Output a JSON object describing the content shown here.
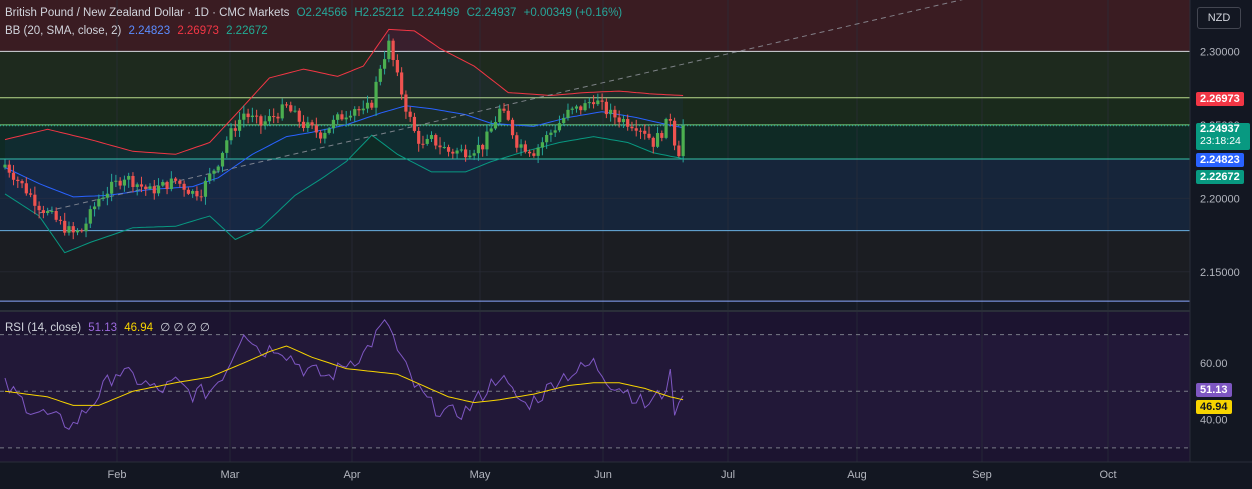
{
  "header": {
    "symbol": "British Pound / New Zealand Dollar · 1D · CMC Markets",
    "open": "O2.24566",
    "high": "H2.25212",
    "low": "L2.24499",
    "close": "C2.24937",
    "change": "+0.00349 (+0.16%)",
    "bb_title": "BB (20, SMA, close, 2)",
    "bb_basis": "2.24823",
    "bb_upper": "2.26973",
    "bb_lower": "2.22672",
    "rsi_title": "RSI (14, close)",
    "rsi_value": "51.13",
    "rsi_ma": "46.94",
    "rsi_extra": "∅ ∅ ∅ ∅"
  },
  "currency": "NZD",
  "colors": {
    "up": "#26a69a",
    "down": "#ef5350",
    "basis": "#2962ff",
    "upper": "#f23645",
    "lower": "#089981",
    "rsi": "#7e57c2",
    "rsi_ma": "#f7d400"
  },
  "chart_data": [
    {
      "type": "candlestick",
      "title": "British Pound / New Zealand Dollar · 1D · CMC Markets",
      "price_ticks": [
        "2.30000",
        "2.25000",
        "2.20000",
        "2.15000"
      ],
      "ylim": [
        2.124,
        2.335
      ],
      "x_ticks": [
        "Feb",
        "Mar",
        "Apr",
        "May",
        "Jun",
        "Jul",
        "Aug",
        "Sep",
        "Oct"
      ],
      "price_labels": {
        "upper": "2.26973",
        "last": "2.24937",
        "countdown": "23:18:24",
        "basis": "2.24823",
        "lower": "2.22672"
      },
      "horizontal_levels": [
        2.3,
        2.2685,
        2.25,
        2.2268,
        2.178,
        2.13
      ],
      "series_keyframes": {
        "close": [
          [
            0,
            2.223
          ],
          [
            8,
            2.195
          ],
          [
            14,
            2.18
          ],
          [
            16,
            2.176
          ],
          [
            18,
            2.178
          ],
          [
            22,
            2.2
          ],
          [
            28,
            2.215
          ],
          [
            34,
            2.205
          ],
          [
            40,
            2.212
          ],
          [
            44,
            2.204
          ],
          [
            46,
            2.205
          ],
          [
            50,
            2.225
          ],
          [
            52,
            2.24
          ],
          [
            56,
            2.258
          ],
          [
            60,
            2.25
          ],
          [
            66,
            2.262
          ],
          [
            70,
            2.25
          ],
          [
            74,
            2.244
          ],
          [
            78,
            2.254
          ],
          [
            82,
            2.262
          ],
          [
            84,
            2.258
          ],
          [
            86,
            2.265
          ],
          [
            88,
            2.29
          ],
          [
            90,
            2.305
          ],
          [
            92,
            2.282
          ],
          [
            94,
            2.262
          ],
          [
            96,
            2.245
          ],
          [
            98,
            2.235
          ],
          [
            100,
            2.24
          ],
          [
            104,
            2.232
          ],
          [
            108,
            2.232
          ],
          [
            112,
            2.236
          ],
          [
            114,
            2.247
          ],
          [
            116,
            2.26
          ],
          [
            118,
            2.252
          ],
          [
            120,
            2.238
          ],
          [
            124,
            2.232
          ],
          [
            128,
            2.245
          ],
          [
            132,
            2.258
          ],
          [
            136,
            2.263
          ],
          [
            138,
            2.268
          ],
          [
            140,
            2.262
          ],
          [
            142,
            2.257
          ],
          [
            146,
            2.252
          ],
          [
            148,
            2.25
          ],
          [
            150,
            2.246
          ],
          [
            152,
            2.238
          ],
          [
            154,
            2.245
          ],
          [
            156,
            2.255
          ],
          [
            157,
            2.239
          ],
          [
            158,
            2.232
          ],
          [
            159,
            2.249
          ]
        ],
        "bb_basis": [
          [
            0,
            2.221
          ],
          [
            8,
            2.21
          ],
          [
            16,
            2.201
          ],
          [
            24,
            2.202
          ],
          [
            34,
            2.206
          ],
          [
            44,
            2.208
          ],
          [
            50,
            2.214
          ],
          [
            58,
            2.23
          ],
          [
            66,
            2.242
          ],
          [
            72,
            2.245
          ],
          [
            80,
            2.25
          ],
          [
            88,
            2.258
          ],
          [
            94,
            2.263
          ],
          [
            100,
            2.261
          ],
          [
            108,
            2.257
          ],
          [
            114,
            2.251
          ],
          [
            124,
            2.249
          ],
          [
            132,
            2.255
          ],
          [
            140,
            2.259
          ],
          [
            148,
            2.255
          ],
          [
            154,
            2.251
          ],
          [
            159,
            2.248
          ]
        ],
        "bb_upper": [
          [
            0,
            2.24
          ],
          [
            10,
            2.247
          ],
          [
            20,
            2.24
          ],
          [
            30,
            2.232
          ],
          [
            40,
            2.23
          ],
          [
            48,
            2.238
          ],
          [
            56,
            2.263
          ],
          [
            62,
            2.282
          ],
          [
            70,
            2.288
          ],
          [
            78,
            2.283
          ],
          [
            84,
            2.29
          ],
          [
            90,
            2.315
          ],
          [
            96,
            2.314
          ],
          [
            102,
            2.302
          ],
          [
            110,
            2.29
          ],
          [
            118,
            2.272
          ],
          [
            128,
            2.27
          ],
          [
            136,
            2.272
          ],
          [
            144,
            2.273
          ],
          [
            152,
            2.271
          ],
          [
            159,
            2.27
          ]
        ],
        "bb_lower": [
          [
            0,
            2.203
          ],
          [
            8,
            2.188
          ],
          [
            14,
            2.163
          ],
          [
            20,
            2.17
          ],
          [
            30,
            2.18
          ],
          [
            40,
            2.181
          ],
          [
            48,
            2.188
          ],
          [
            54,
            2.172
          ],
          [
            60,
            2.18
          ],
          [
            68,
            2.202
          ],
          [
            74,
            2.213
          ],
          [
            80,
            2.225
          ],
          [
            86,
            2.243
          ],
          [
            92,
            2.23
          ],
          [
            100,
            2.218
          ],
          [
            108,
            2.218
          ],
          [
            114,
            2.225
          ],
          [
            122,
            2.232
          ],
          [
            130,
            2.238
          ],
          [
            138,
            2.242
          ],
          [
            146,
            2.238
          ],
          [
            152,
            2.231
          ],
          [
            159,
            2.227
          ]
        ],
        "trend_start": [
          8,
          2.19
        ],
        "trend_end": [
          239,
          2.345
        ]
      },
      "bar_count": 160
    },
    {
      "type": "line",
      "title": "RSI (14, close)",
      "ticks": [
        "60.00",
        "40.00"
      ],
      "ylim": [
        25,
        78
      ],
      "levels": [
        70,
        50,
        30
      ],
      "value_labels": {
        "rsi": "51.13",
        "rsi_ma": "46.94"
      },
      "series": [
        {
          "name": "RSI",
          "keyframes": [
            [
              0,
              52
            ],
            [
              6,
              44
            ],
            [
              12,
              40
            ],
            [
              16,
              38
            ],
            [
              20,
              45
            ],
            [
              26,
              57
            ],
            [
              30,
              55
            ],
            [
              36,
              50
            ],
            [
              40,
              53
            ],
            [
              44,
              49
            ],
            [
              48,
              50
            ],
            [
              52,
              58
            ],
            [
              56,
              72
            ],
            [
              60,
              64
            ],
            [
              64,
              66
            ],
            [
              70,
              58
            ],
            [
              76,
              55
            ],
            [
              80,
              60
            ],
            [
              84,
              63
            ],
            [
              88,
              72
            ],
            [
              90,
              74
            ],
            [
              92,
              64
            ],
            [
              96,
              52
            ],
            [
              100,
              45
            ],
            [
              104,
              42
            ],
            [
              108,
              43
            ],
            [
              112,
              49
            ],
            [
              116,
              56
            ],
            [
              118,
              51
            ],
            [
              122,
              45
            ],
            [
              126,
              49
            ],
            [
              130,
              55
            ],
            [
              134,
              57
            ],
            [
              138,
              60
            ],
            [
              142,
              53
            ],
            [
              146,
              50
            ],
            [
              150,
              45
            ],
            [
              154,
              49
            ],
            [
              156,
              55
            ],
            [
              157,
              44
            ],
            [
              158,
              44
            ],
            [
              159,
              51
            ]
          ]
        },
        {
          "name": "RSI-based MA",
          "keyframes": [
            [
              0,
              50
            ],
            [
              10,
              48
            ],
            [
              16,
              45
            ],
            [
              22,
              45
            ],
            [
              30,
              50
            ],
            [
              40,
              53
            ],
            [
              48,
              55
            ],
            [
              56,
              60
            ],
            [
              62,
              64
            ],
            [
              66,
              66
            ],
            [
              72,
              62
            ],
            [
              80,
              58
            ],
            [
              86,
              57
            ],
            [
              92,
              56
            ],
            [
              98,
              52
            ],
            [
              104,
              48
            ],
            [
              110,
              46
            ],
            [
              116,
              47
            ],
            [
              124,
              49
            ],
            [
              132,
              52
            ],
            [
              138,
              53
            ],
            [
              144,
              53
            ],
            [
              150,
              51
            ],
            [
              156,
              48
            ],
            [
              159,
              47
            ]
          ]
        }
      ]
    }
  ]
}
